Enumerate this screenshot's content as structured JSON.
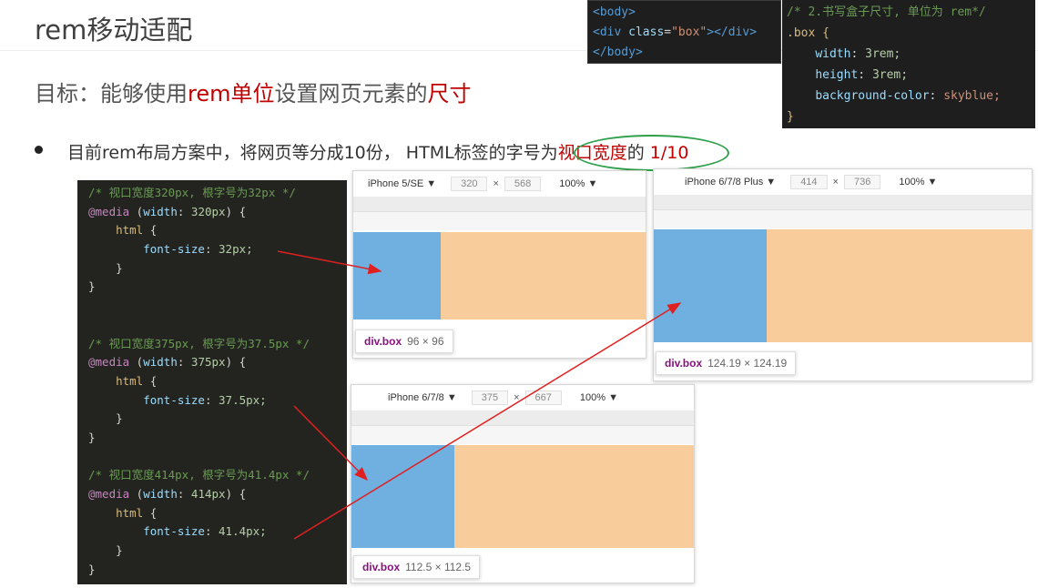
{
  "title": "rem移动适配",
  "goal": {
    "prefix": "目标：能够使用",
    "em1": "rem单位",
    "mid": "设置网页元素的",
    "em2": "尺寸"
  },
  "bullet": {
    "prefix": "目前rem布局方案中，将网页等分成10份， HTML标签的字号为",
    "em1": "视口宽度",
    "mid": "的 ",
    "em2": "1/10"
  },
  "code_html": {
    "l1": "<body>",
    "l2a": "<div ",
    "l2b": "class",
    "l2c": "=",
    "l2d": "\"box\"",
    "l2e": "></div>",
    "l3": "</body>"
  },
  "code_css": {
    "comment": "/* 2.书写盒子尺寸, 单位为 rem*/",
    "selector": ".box {",
    "p1": "width",
    "v1num": "3",
    "v1unit": "rem;",
    "p2": "height",
    "v2num": "3",
    "v2unit": "rem;",
    "p3": "background-color",
    "v3": "skyblue;",
    "close": "}"
  },
  "code_media": [
    {
      "comment": "/* 视口宽度320px, 根字号为32px */",
      "media": "@media",
      "cond_prop": "width",
      "cond_val": "320px",
      "fs": "32px;"
    },
    {
      "comment": "/* 视口宽度375px, 根字号为37.5px */",
      "media": "@media",
      "cond_prop": "width",
      "cond_val": "375px",
      "fs": "37.5px;"
    },
    {
      "comment": "/* 视口宽度414px, 根字号为41.4px */",
      "media": "@media",
      "cond_prop": "width",
      "cond_val": "414px",
      "fs": "41.4px;"
    }
  ],
  "code_tokens": {
    "html": "html",
    "brace_open": "{",
    "brace_close": "}",
    "font_size": "font-size",
    "colon": ":"
  },
  "devices": [
    {
      "name": "iPhone 5/SE",
      "w": "320",
      "h": "568",
      "zoom": "100%",
      "tip_tag": "div.box",
      "tip_dim": "96 × 96"
    },
    {
      "name": "iPhone 6/7/8 Plus",
      "w": "414",
      "h": "736",
      "zoom": "100%",
      "tip_tag": "div.box",
      "tip_dim": "124.19 × 124.19"
    },
    {
      "name": "iPhone 6/7/8",
      "w": "375",
      "h": "667",
      "zoom": "100%",
      "tip_tag": "div.box",
      "tip_dim": "112.5 × 112.5"
    }
  ],
  "colors": {
    "box": "#6fb0e0",
    "margin_overlay": "#f8cc9b",
    "arrow": "#e02020",
    "highlight_oval": "#2ea04a",
    "emphasis": "#c00000"
  }
}
